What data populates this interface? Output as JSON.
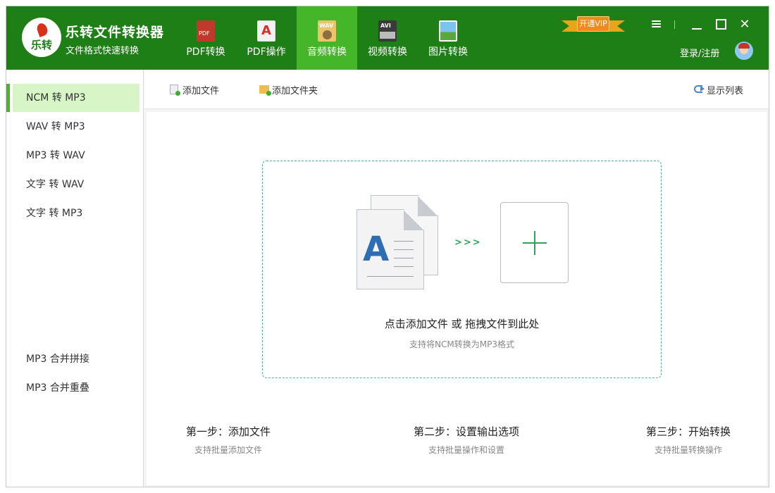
{
  "app": {
    "logo_text": "乐转",
    "name": "乐转文件转换器",
    "subtitle": "文件格式快速转换"
  },
  "nav": {
    "items": [
      {
        "label": "PDF转换",
        "icon": "pdf-file-icon",
        "active": false
      },
      {
        "label": "PDF操作",
        "icon": "pdf-acrobat-icon",
        "active": false
      },
      {
        "label": "音频转换",
        "icon": "audio-wav-icon",
        "active": true
      },
      {
        "label": "视频转换",
        "icon": "video-avi-icon",
        "active": false
      },
      {
        "label": "图片转换",
        "icon": "image-picture-icon",
        "active": false
      }
    ]
  },
  "header": {
    "vip_label": "开通VIP",
    "login_label": "登录/注册",
    "menu_icon": "hamburger-menu-icon",
    "minimize_icon": "minimize-icon",
    "maximize_icon": "maximize-icon",
    "close_icon": "close-icon",
    "close_glyph": "✕"
  },
  "sidebar": {
    "items": [
      {
        "label": "NCM 转 MP3",
        "active": true
      },
      {
        "label": "WAV 转 MP3",
        "active": false
      },
      {
        "label": "MP3 转 WAV",
        "active": false
      },
      {
        "label": "文字 转 WAV",
        "active": false
      },
      {
        "label": "文字 转 MP3",
        "active": false
      },
      {
        "label": "MP3 合并拼接",
        "active": false
      },
      {
        "label": "MP3 合并重叠",
        "active": false
      }
    ]
  },
  "toolbar": {
    "add_file": "添加文件",
    "add_folder": "添加文件夹",
    "show_list": "显示列表"
  },
  "dropzone": {
    "doc_letter": "A",
    "arrows": ">>>",
    "title": "点击添加文件 或 拖拽文件到此处",
    "subtitle": "支持将NCM转换为MP3格式"
  },
  "steps": [
    {
      "title": "第一步：添加文件",
      "subtitle": "支持批量添加文件"
    },
    {
      "title": "第二步：设置输出选项",
      "subtitle": "支持批量操作和设置"
    },
    {
      "title": "第三步：开始转换",
      "subtitle": "支持批量转换操作"
    }
  ],
  "colors": {
    "header_bg": "#1f7f17",
    "nav_active": "#45b62a",
    "sidebar_active": "#d7f5c6",
    "accent_green": "#2ea45a",
    "dashed_border": "#52b08d"
  }
}
